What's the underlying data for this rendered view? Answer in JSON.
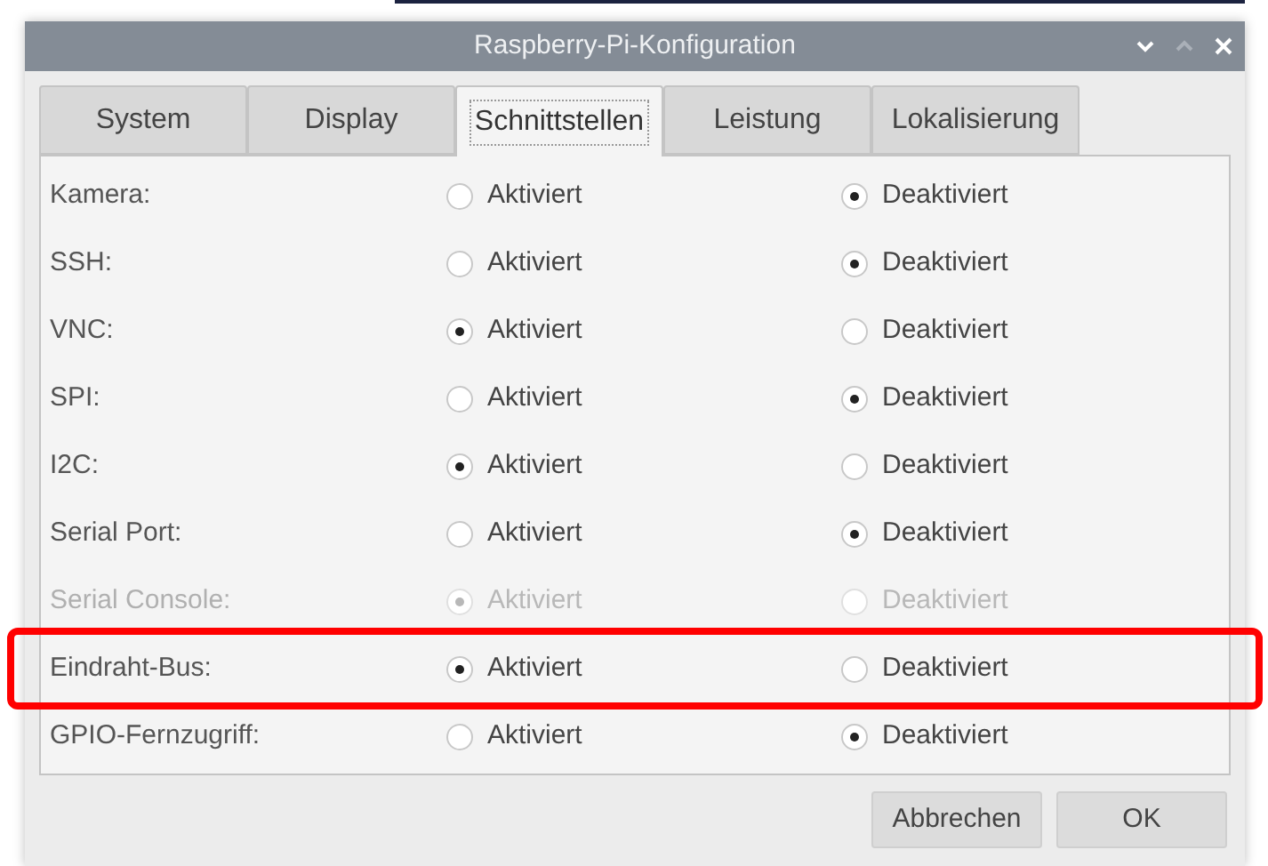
{
  "window": {
    "title": "Raspberry-Pi-Konfiguration"
  },
  "tabs": [
    {
      "label": "System",
      "selected": false
    },
    {
      "label": "Display",
      "selected": false
    },
    {
      "label": "Schnittstellen",
      "selected": true
    },
    {
      "label": "Leistung",
      "selected": false
    },
    {
      "label": "Lokalisierung",
      "selected": false
    }
  ],
  "rows": [
    {
      "label": "Kamera:",
      "disabled": false,
      "highlighted": false,
      "options": [
        {
          "label": "Aktiviert",
          "selected": false
        },
        {
          "label": "Deaktiviert",
          "selected": true
        }
      ]
    },
    {
      "label": "SSH:",
      "disabled": false,
      "highlighted": false,
      "options": [
        {
          "label": "Aktiviert",
          "selected": false
        },
        {
          "label": "Deaktiviert",
          "selected": true
        }
      ]
    },
    {
      "label": "VNC:",
      "disabled": false,
      "highlighted": false,
      "options": [
        {
          "label": "Aktiviert",
          "selected": true
        },
        {
          "label": "Deaktiviert",
          "selected": false
        }
      ]
    },
    {
      "label": "SPI:",
      "disabled": false,
      "highlighted": false,
      "options": [
        {
          "label": "Aktiviert",
          "selected": false
        },
        {
          "label": "Deaktiviert",
          "selected": true
        }
      ]
    },
    {
      "label": "I2C:",
      "disabled": false,
      "highlighted": false,
      "options": [
        {
          "label": "Aktiviert",
          "selected": true
        },
        {
          "label": "Deaktiviert",
          "selected": false
        }
      ]
    },
    {
      "label": "Serial Port:",
      "disabled": false,
      "highlighted": false,
      "options": [
        {
          "label": "Aktiviert",
          "selected": false
        },
        {
          "label": "Deaktiviert",
          "selected": true
        }
      ]
    },
    {
      "label": "Serial Console:",
      "disabled": true,
      "highlighted": false,
      "options": [
        {
          "label": "Aktiviert",
          "selected": true
        },
        {
          "label": "Deaktiviert",
          "selected": false
        }
      ]
    },
    {
      "label": "Eindraht-Bus:",
      "disabled": false,
      "highlighted": true,
      "options": [
        {
          "label": "Aktiviert",
          "selected": true
        },
        {
          "label": "Deaktiviert",
          "selected": false
        }
      ]
    },
    {
      "label": "GPIO-Fernzugriff:",
      "disabled": false,
      "highlighted": false,
      "options": [
        {
          "label": "Aktiviert",
          "selected": false
        },
        {
          "label": "Deaktiviert",
          "selected": true
        }
      ]
    }
  ],
  "buttons": [
    "Abbrechen",
    "OK"
  ]
}
